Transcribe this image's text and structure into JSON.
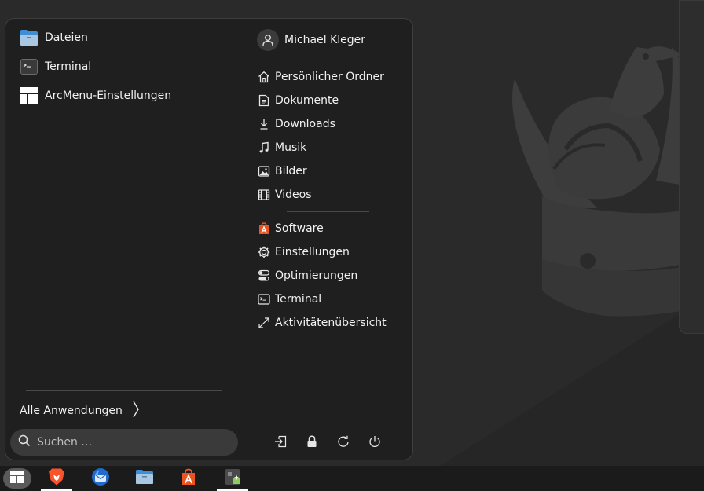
{
  "apps": [
    {
      "label": "Dateien",
      "icon": "files-folder-icon"
    },
    {
      "label": "Terminal",
      "icon": "terminal-icon"
    },
    {
      "label": "ArcMenu-Einstellungen",
      "icon": "arcmenu-layout-icon"
    }
  ],
  "all_apps_label": "Alle Anwendungen",
  "search": {
    "placeholder": "Suchen …",
    "value": ""
  },
  "user": {
    "name": "Michael Kleger",
    "icon": "user-avatar-icon"
  },
  "places": [
    {
      "label": "Persönlicher Ordner",
      "icon": "home-icon"
    },
    {
      "label": "Dokumente",
      "icon": "document-icon"
    },
    {
      "label": "Downloads",
      "icon": "download-icon"
    },
    {
      "label": "Musik",
      "icon": "music-icon"
    },
    {
      "label": "Bilder",
      "icon": "image-icon"
    },
    {
      "label": "Videos",
      "icon": "film-icon"
    }
  ],
  "shortcuts": [
    {
      "label": "Software",
      "icon": "software-store-icon"
    },
    {
      "label": "Einstellungen",
      "icon": "settings-gear-icon"
    },
    {
      "label": "Optimierungen",
      "icon": "tweaks-toggle-icon"
    },
    {
      "label": "Terminal",
      "icon": "terminal-icon"
    },
    {
      "label": "Aktivitätenübersicht",
      "icon": "expand-arrows-icon"
    }
  ],
  "session_buttons": [
    "logout-icon",
    "lock-icon",
    "restart-icon",
    "power-icon"
  ],
  "taskbar": [
    {
      "name": "arcmenu-button",
      "icon": "arcmenu-layout-icon",
      "active": true
    },
    {
      "name": "brave-browser",
      "icon": "brave-lion-icon",
      "running": true
    },
    {
      "name": "thunderbird",
      "icon": "thunderbird-icon"
    },
    {
      "name": "files",
      "icon": "files-folder-icon"
    },
    {
      "name": "software",
      "icon": "software-store-icon"
    },
    {
      "name": "extension-manager",
      "icon": "puzzle-icon",
      "running": true
    }
  ],
  "colors": {
    "menu_bg": "#1f1f1f",
    "accent": "#e95420",
    "taskbar_bg": "#1b1b1b"
  }
}
